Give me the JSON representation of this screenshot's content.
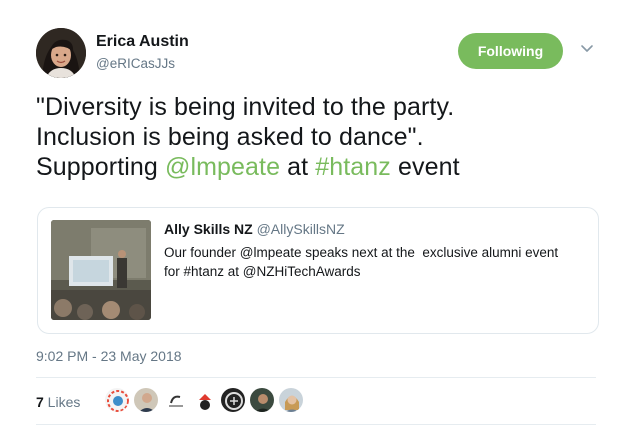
{
  "tweet": {
    "author_name": "Erica Austin",
    "author_handle": "@eRICasJJs",
    "follow_label": "Following",
    "text_line1": "\"Diversity is being invited to the party.",
    "text_line2": "Inclusion is being asked to dance\".",
    "text_line3_prefix": "Supporting ",
    "mention": "@lmpeate",
    "text_line3_mid": " at ",
    "hashtag": "#htanz",
    "text_line3_suffix": " event",
    "timestamp": "9:02 PM - 23 May 2018",
    "likes_count": "7",
    "likes_label": " Likes"
  },
  "quote": {
    "author_name": "Ally Skills NZ",
    "author_handle": "@AllySkillsNZ",
    "body_line1": "Our founder @lmpeate speaks next at the  exclusive alumni event",
    "body_line2": "for #htanz at @NZHiTechAwards"
  },
  "likers": [
    "liker-avatar-1",
    "liker-avatar-2",
    "liker-avatar-3",
    "liker-avatar-4",
    "liker-avatar-5",
    "liker-avatar-6",
    "liker-avatar-7"
  ],
  "colors": {
    "accent": "#79bb5d",
    "secondary_text": "#657786",
    "border": "#e1e8ed"
  },
  "icons": {
    "menu": "chevron-down-icon"
  }
}
